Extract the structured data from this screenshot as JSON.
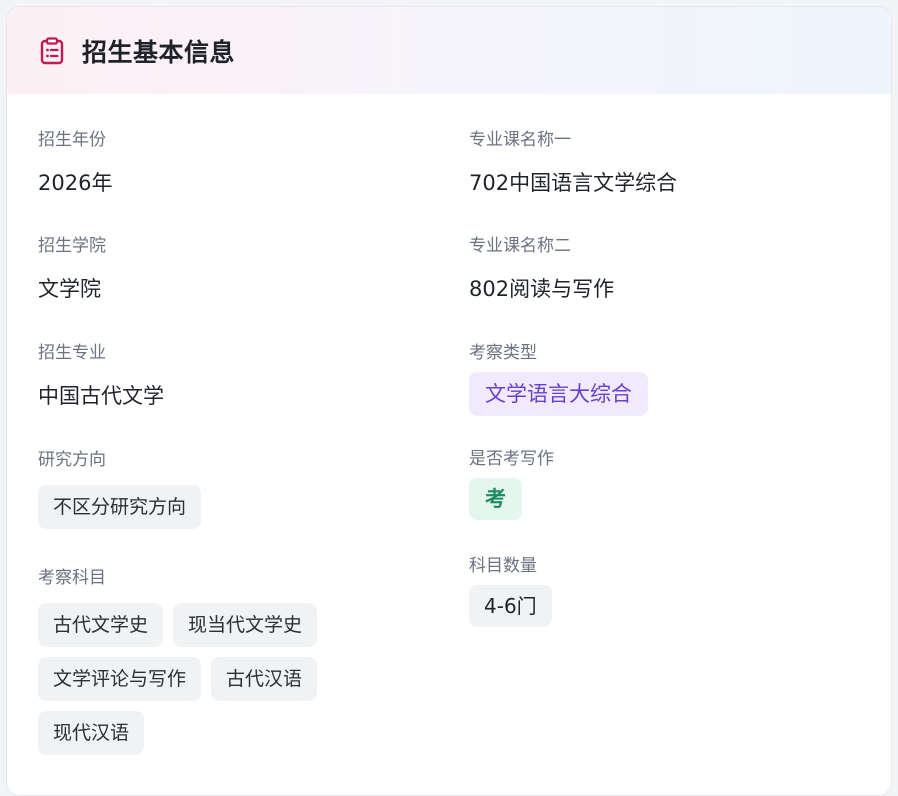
{
  "header": {
    "title": "招生基本信息",
    "icon": "clipboard-icon",
    "accent": "#c0194f"
  },
  "left": {
    "year": {
      "label": "招生年份",
      "value": "2026年"
    },
    "college": {
      "label": "招生学院",
      "value": "文学院"
    },
    "major": {
      "label": "招生专业",
      "value": "中国古代文学"
    },
    "direction": {
      "label": "研究方向",
      "tag": "不区分研究方向"
    },
    "subjects": {
      "label": "考察科目",
      "tags": [
        "古代文学史",
        "现当代文学史",
        "文学评论与写作",
        "古代汉语",
        "现代汉语"
      ]
    }
  },
  "right": {
    "course1": {
      "label": "专业课名称一",
      "value": "702中国语言文学综合"
    },
    "course2": {
      "label": "专业课名称二",
      "value": "802阅读与写作"
    },
    "exam_type": {
      "label": "考察类型",
      "tag": "文学语言大综合",
      "color": "#6a3fd0"
    },
    "writing": {
      "label": "是否考写作",
      "tag": "考",
      "color": "#1f8a5b"
    },
    "count": {
      "label": "科目数量",
      "tag": "4-6门"
    }
  }
}
